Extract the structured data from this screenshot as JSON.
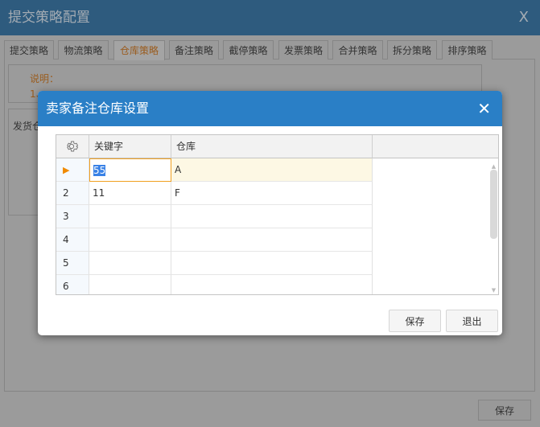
{
  "window": {
    "title": "提交策略配置",
    "close": "X"
  },
  "tabs": [
    {
      "label": "提交策略"
    },
    {
      "label": "物流策略"
    },
    {
      "label": "仓库策略",
      "active": true
    },
    {
      "label": "备注策略"
    },
    {
      "label": "截停策略"
    },
    {
      "label": "发票策略"
    },
    {
      "label": "合并策略"
    },
    {
      "label": "拆分策略"
    },
    {
      "label": "排序策略"
    }
  ],
  "note": {
    "heading": "说明：",
    "line1": "1、"
  },
  "section2": {
    "label": "发货仓"
  },
  "footer": {
    "save": "保存"
  },
  "dialog": {
    "title": "卖家备注仓库设置",
    "close": "✕",
    "columns": [
      "关键字",
      "仓库"
    ],
    "rows": [
      {
        "n": "",
        "keyword": "55",
        "warehouse": "A"
      },
      {
        "n": "2",
        "keyword": "11",
        "warehouse": "F"
      },
      {
        "n": "3",
        "keyword": "",
        "warehouse": ""
      },
      {
        "n": "4",
        "keyword": "",
        "warehouse": ""
      },
      {
        "n": "5",
        "keyword": "",
        "warehouse": ""
      },
      {
        "n": "6",
        "keyword": "",
        "warehouse": ""
      }
    ],
    "save": "保存",
    "exit": "退出"
  },
  "colors": {
    "accent": "#2a7fc6",
    "current_row": "#fdf8e4",
    "active_tab_text": "#9a5c1e"
  }
}
